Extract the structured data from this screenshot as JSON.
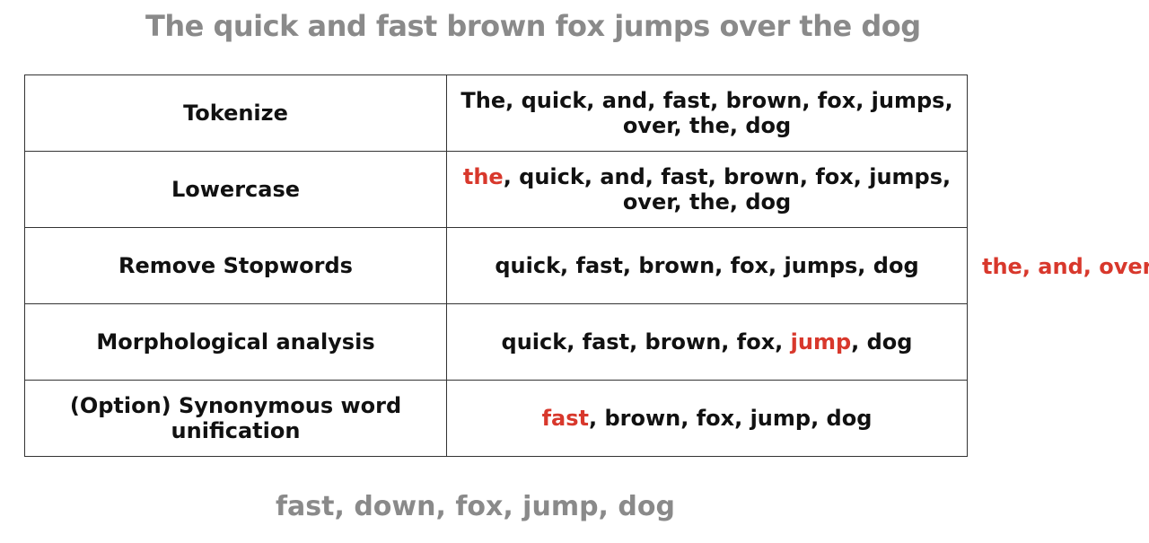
{
  "header": {
    "sentence": "The quick and fast brown fox jumps over the dog"
  },
  "steps": [
    {
      "name": "Tokenize",
      "output_before": "The, quick, and, fast, brown, fox, jumps, over, the, dog",
      "highlight": "",
      "output_after": ""
    },
    {
      "name": "Lowercase",
      "output_before": "",
      "highlight": "the",
      "output_after": ", quick, and, fast, brown, fox, jumps, over, the, dog"
    },
    {
      "name": "Remove Stopwords",
      "output_before": "quick, fast, brown, fox, jumps, dog",
      "highlight": "",
      "output_after": ""
    },
    {
      "name": "Morphological analysis",
      "output_before": "quick, fast, brown, fox, ",
      "highlight": "jump",
      "output_after": ", dog"
    },
    {
      "name": "(Option) Synonymous word unification",
      "output_before": "",
      "highlight": "fast",
      "output_after": ", brown, fox, jump, dog"
    }
  ],
  "removed_stopwords": "the, and, over",
  "footer": {
    "result": "fast, down, fox, jump, dog"
  },
  "colors": {
    "highlight": "#d8382c",
    "muted_text": "#8a8a8a",
    "border": "#333333"
  }
}
